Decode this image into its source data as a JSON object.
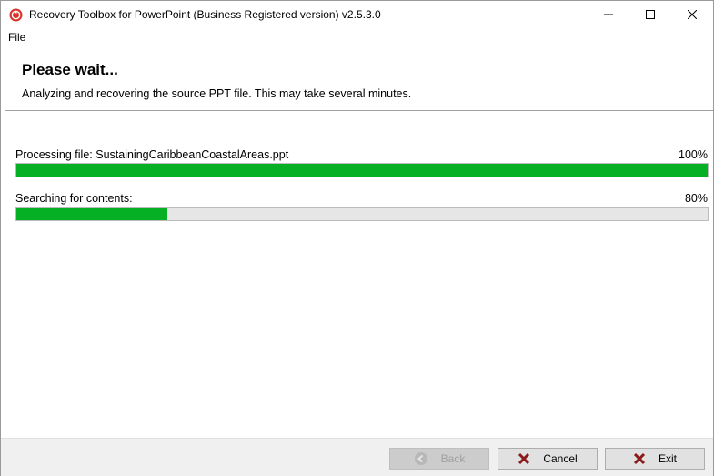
{
  "window": {
    "title": "Recovery Toolbox for PowerPoint (Business Registered version) v2.5.3.0"
  },
  "menu": {
    "file": "File"
  },
  "header": {
    "title": "Please wait...",
    "subtitle": "Analyzing and recovering the source PPT file. This may take several minutes."
  },
  "progress": [
    {
      "label": "Processing file: SustainingCaribbeanCoastalAreas.ppt",
      "percent_text": "100%",
      "fill_fraction": 1.0
    },
    {
      "label": "Searching for contents:",
      "percent_text": "80%",
      "fill_fraction": 0.218
    }
  ],
  "footer": {
    "back_label": "Back",
    "cancel_label": "Cancel",
    "exit_label": "Exit"
  },
  "colors": {
    "progress_fill": "#06b025",
    "progress_track": "#e6e6e6",
    "cancel_x": "#8b1a1a",
    "app_icon": "#d9342b"
  },
  "icons": {
    "app": "recovery-toolbox-icon",
    "minimize": "minimize-icon",
    "maximize": "maximize-icon",
    "close": "close-icon",
    "back": "back-arrow-icon",
    "cancel": "x-icon",
    "exit": "x-icon"
  }
}
